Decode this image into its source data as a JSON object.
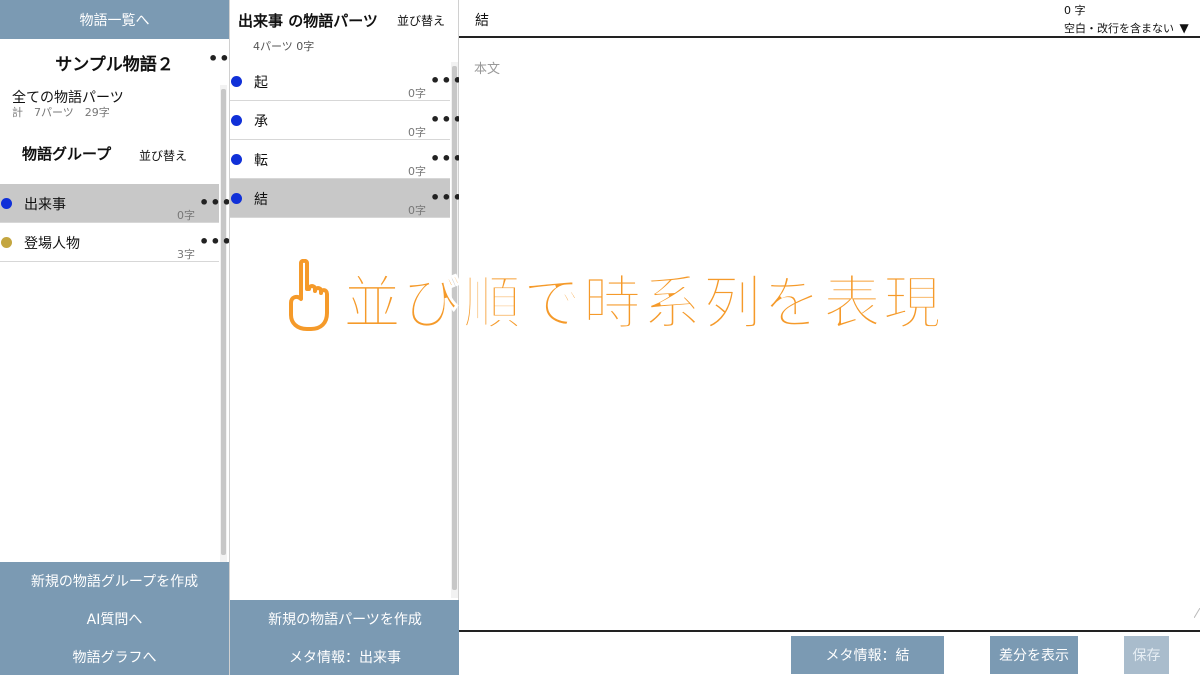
{
  "left": {
    "nav_top": "物語一覧へ",
    "story_title": "サンプル物語２",
    "all_parts_label": "全ての物語パーツ",
    "all_parts_total": "計　7パーツ　29字",
    "groups_heading": "物語グループ",
    "groups_sort": "並び替え",
    "groups": [
      {
        "label": "出来事",
        "count": "0字",
        "dot_color": "#1030d8",
        "selected": true
      },
      {
        "label": "登場人物",
        "count": "3字",
        "dot_color": "#c4a640",
        "selected": false
      }
    ],
    "new_group": "新規の物語グループを作成",
    "ai_link": "AI質問へ",
    "graph_link": "物語グラフへ"
  },
  "middle": {
    "title": "出来事 の物語パーツ",
    "sort": "並び替え",
    "subtitle": "4パーツ 0字",
    "parts": [
      {
        "label": "起",
        "count": "0字",
        "dot_color": "#1030d8",
        "selected": false
      },
      {
        "label": "承",
        "count": "0字",
        "dot_color": "#1030d8",
        "selected": false
      },
      {
        "label": "転",
        "count": "0字",
        "dot_color": "#1030d8",
        "selected": false
      },
      {
        "label": "結",
        "count": "0字",
        "dot_color": "#1030d8",
        "selected": true
      }
    ],
    "new_part": "新規の物語パーツを作成",
    "meta": "メタ情報：出来事"
  },
  "editor": {
    "title": "結",
    "char_count": "0 字",
    "count_mode": "空白・改行を含まない",
    "placeholder": "本文",
    "meta_button": "メタ情報：結",
    "diff_button": "差分を表示",
    "save_button": "保存"
  },
  "overlay": {
    "caption": "並び順で時系列を表現",
    "color": "#f59a2a",
    "icon": "pointing-up-hand-icon"
  },
  "colors": {
    "accent": "#7b9ab3",
    "selected_row": "#c8c8c8"
  }
}
